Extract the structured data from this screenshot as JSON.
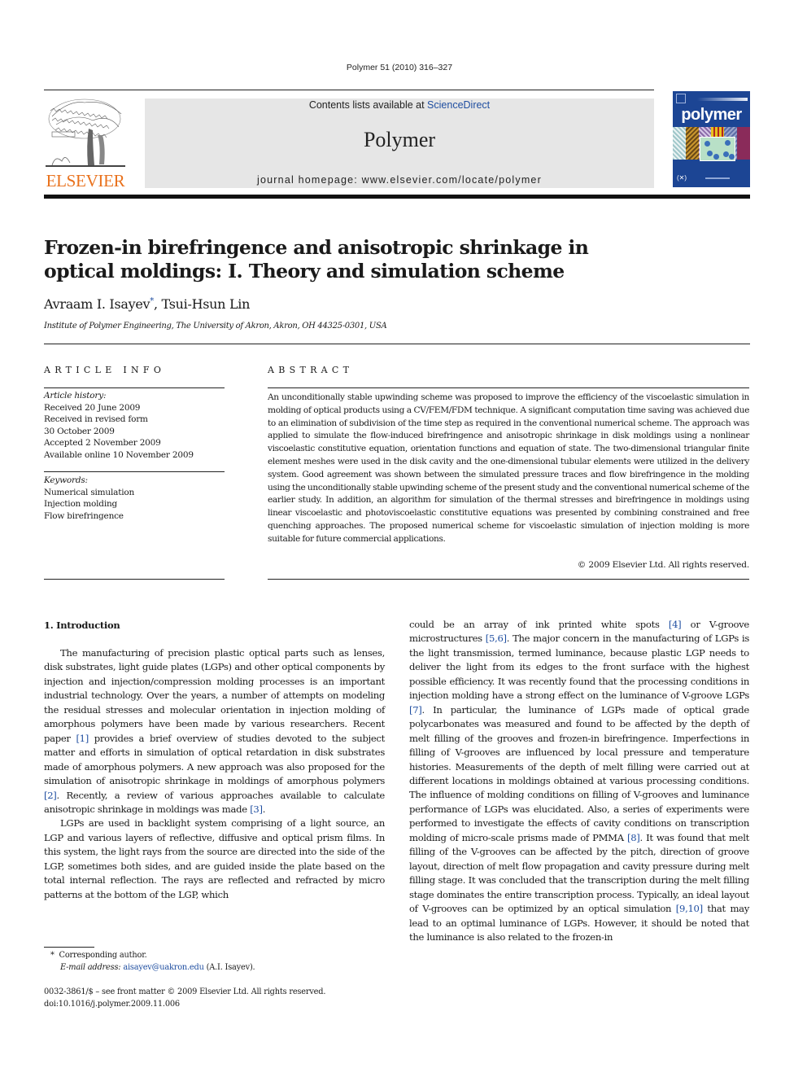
{
  "header": {
    "journal_ref": "Polymer 51 (2010) 316–327",
    "contents_prefix": "Contents lists available at ",
    "contents_link": "ScienceDirect",
    "journal_name": "Polymer",
    "homepage": "journal homepage: www.elsevier.com/locate/polymer",
    "publisher_logo_text": "ELSEVIER",
    "cover_title": "polymer",
    "cover_mark": "(✕)"
  },
  "colors": {
    "link": "#1f4ea0",
    "elsevier_orange": "#e9711c",
    "masthead_bg": "#e6e6e6",
    "cover_blue": "#1c4594"
  },
  "article": {
    "title": "Frozen-in birefringence and anisotropic shrinkage in optical moldings: I. Theory and simulation scheme",
    "authors": [
      {
        "name": "Avraam I. Isayev",
        "mark": "*"
      },
      {
        "name": "Tsui-Hsun Lin",
        "mark": ""
      }
    ],
    "author_separator": ", ",
    "affiliation": "Institute of Polymer Engineering, The University of Akron, Akron, OH 44325-0301, USA"
  },
  "article_info": {
    "heading": "ARTICLE INFO",
    "history_label": "Article history:",
    "history": [
      "Received 20 June 2009",
      "Received in revised form",
      "30 October 2009",
      "Accepted 2 November 2009",
      "Available online 10 November 2009"
    ],
    "keywords_label": "Keywords:",
    "keywords": [
      "Numerical simulation",
      "Injection molding",
      "Flow birefringence"
    ]
  },
  "abstract": {
    "heading": "ABSTRACT",
    "text": "An unconditionally stable upwinding scheme was proposed to improve the efficiency of the viscoelastic simulation in molding of optical products using a CV/FEM/FDM technique. A significant computation time saving was achieved due to an elimination of subdivision of the time step as required in the conventional numerical scheme. The approach was applied to simulate the flow-induced birefringence and anisotropic shrinkage in disk moldings using a nonlinear viscoelastic constitutive equation, orientation functions and equation of state. The two-dimensional triangular finite element meshes were used in the disk cavity and the one-dimensional tubular elements were utilized in the delivery system. Good agreement was shown between the simulated pressure traces and flow birefringence in the molding using the unconditionally stable upwinding scheme of the present study and the conventional numerical scheme of the earlier study. In addition, an algorithm for simulation of the thermal stresses and birefringence in moldings using linear viscoelastic and photoviscoelastic constitutive equations was presented by combining constrained and free quenching approaches. The proposed numerical scheme for viscoelastic simulation of injection molding is more suitable for future commercial applications.",
    "copyright": "© 2009 Elsevier Ltd. All rights reserved."
  },
  "introduction": {
    "heading": "1.  Introduction",
    "left_column": [
      {
        "segments": [
          {
            "t": "The manufacturing of precision plastic optical parts such as lenses, disk substrates, light guide plates (LGPs) and other optical components by injection and injection/compression molding processes is an important industrial technology. Over the years, a number of attempts on modeling the residual stresses and molecular orientation in injection molding of amorphous polymers have been made by various researchers. Recent paper "
          },
          {
            "t": "[1]",
            "ref": true
          },
          {
            "t": " provides a brief overview of studies devoted to the subject matter and efforts in simulation of optical retardation in disk substrates made of amorphous polymers. A new approach was also proposed for the simulation of anisotropic shrinkage in moldings of amorphous polymers "
          },
          {
            "t": "[2]",
            "ref": true
          },
          {
            "t": ". Recently, a review of various approaches available to calculate anisotropic shrinkage in moldings was made "
          },
          {
            "t": "[3]",
            "ref": true
          },
          {
            "t": "."
          }
        ]
      },
      {
        "segments": [
          {
            "t": "LGPs are used in backlight system comprising of a light source, an LGP and various layers of reflective, diffusive and optical prism films. In this system, the light rays from the source are directed into the side of the LGP, sometimes both sides, and are guided inside the plate based on the total internal reflection. The rays are reflected and refracted by micro patterns at the bottom of the LGP, which"
          }
        ]
      }
    ],
    "right_column": [
      {
        "segments": [
          {
            "t": "could be an array of ink printed white spots "
          },
          {
            "t": "[4]",
            "ref": true
          },
          {
            "t": " or V-groove microstructures "
          },
          {
            "t": "[5,6]",
            "ref": true
          },
          {
            "t": ". The major concern in the manufacturing of LGPs is the light transmission, termed luminance, because plastic LGP needs to deliver the light from its edges to the front surface with the highest possible efficiency. It was recently found that the processing conditions in injection molding have a strong effect on the luminance of V-groove LGPs "
          },
          {
            "t": "[7]",
            "ref": true
          },
          {
            "t": ". In particular, the luminance of LGPs made of optical grade polycarbonates was measured and found to be affected by the depth of melt filling of the grooves and frozen-in birefringence. Imperfections in filling of V-grooves are influenced by local pressure and temperature histories. Measurements of the depth of melt filling were carried out at different locations in moldings obtained at various processing conditions. The influence of molding conditions on filling of V-grooves and luminance performance of LGPs was elucidated. Also, a series of experiments were performed to investigate the effects of cavity conditions on transcription molding of micro-scale prisms made of PMMA "
          },
          {
            "t": "[8]",
            "ref": true
          },
          {
            "t": ". It was found that melt filling of the V-grooves can be affected by the pitch, direction of groove layout, direction of melt flow propagation and cavity pressure during melt filling stage. It was concluded that the transcription during the melt filling stage dominates the entire transcription process. Typically, an ideal layout of V-grooves can be optimized by an optical simulation "
          },
          {
            "t": "[9,10]",
            "ref": true
          },
          {
            "t": " that may lead to an optimal luminance of LGPs. However, it should be noted that the luminance is also related to the frozen-in"
          }
        ]
      }
    ]
  },
  "footnote": {
    "star": "*",
    "corresponding": "Corresponding author.",
    "email_label": "E-mail address:",
    "email": "aisayev@uakron.edu",
    "email_owner": "(A.I. Isayev)."
  },
  "front_matter": {
    "issn_line": "0032-3861/$ – see front matter © 2009 Elsevier Ltd. All rights reserved.",
    "doi": "doi:10.1016/j.polymer.2009.11.006"
  }
}
